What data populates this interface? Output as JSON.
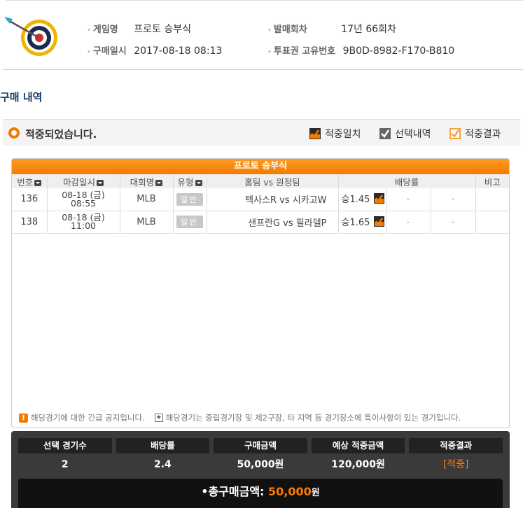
{
  "header": {
    "game_name_label": "게임명",
    "game_name": "프로토 승부식",
    "purchase_date_label": "구매일시",
    "purchase_date": "2017-08-18 08:13",
    "round_label": "발매회차",
    "round": "17년 66회차",
    "ticket_id_label": "투표권 고유번호",
    "ticket_id": "9B0D-8982-F170-B810"
  },
  "section_title": "구매 내역",
  "status": {
    "text": "적중되었습니다.",
    "legend": [
      {
        "label": "적중일치",
        "style": "dark"
      },
      {
        "label": "선택내역",
        "style": "gray"
      },
      {
        "label": "적중결과",
        "style": "orange"
      }
    ]
  },
  "panel": {
    "title": "프로토 승부식",
    "columns": [
      "번호",
      "마감일시",
      "대회명",
      "유형",
      "홈팀 vs 원정팀",
      "배당률",
      "비고"
    ],
    "rows": [
      {
        "no": "136",
        "date1": "08-18 (금)",
        "date2": "08:55",
        "league": "MLB",
        "type": "일반",
        "match": "텍사스R vs 시카고W",
        "odds": "승1.45",
        "o2": "-",
        "o3": "-"
      },
      {
        "no": "138",
        "date1": "08-18 (금)",
        "date2": "11:00",
        "league": "MLB",
        "type": "일반",
        "match": "샌프란G vs 필라델P",
        "odds": "승1.65",
        "o2": "-",
        "o3": "-"
      }
    ],
    "notice1": "해당경기에 대한 긴급 공지입니다.",
    "notice2": "해당경기는 중립경기장 및 제2구장, 타 지역 등 경기장소에 특이사항이 있는 경기입니다."
  },
  "summary": {
    "heads": [
      "선택 경기수",
      "배당률",
      "구매금액",
      "예상 적중금액",
      "적중결과"
    ],
    "values": [
      "2",
      "2.4",
      "50,000원",
      "120,000원",
      "[적중]"
    ],
    "total_label": "•총구매금액: ",
    "total_amount": "50,000",
    "total_unit": "원"
  },
  "colors": {
    "accent": "#f47a00",
    "navy": "#1a3e66"
  }
}
